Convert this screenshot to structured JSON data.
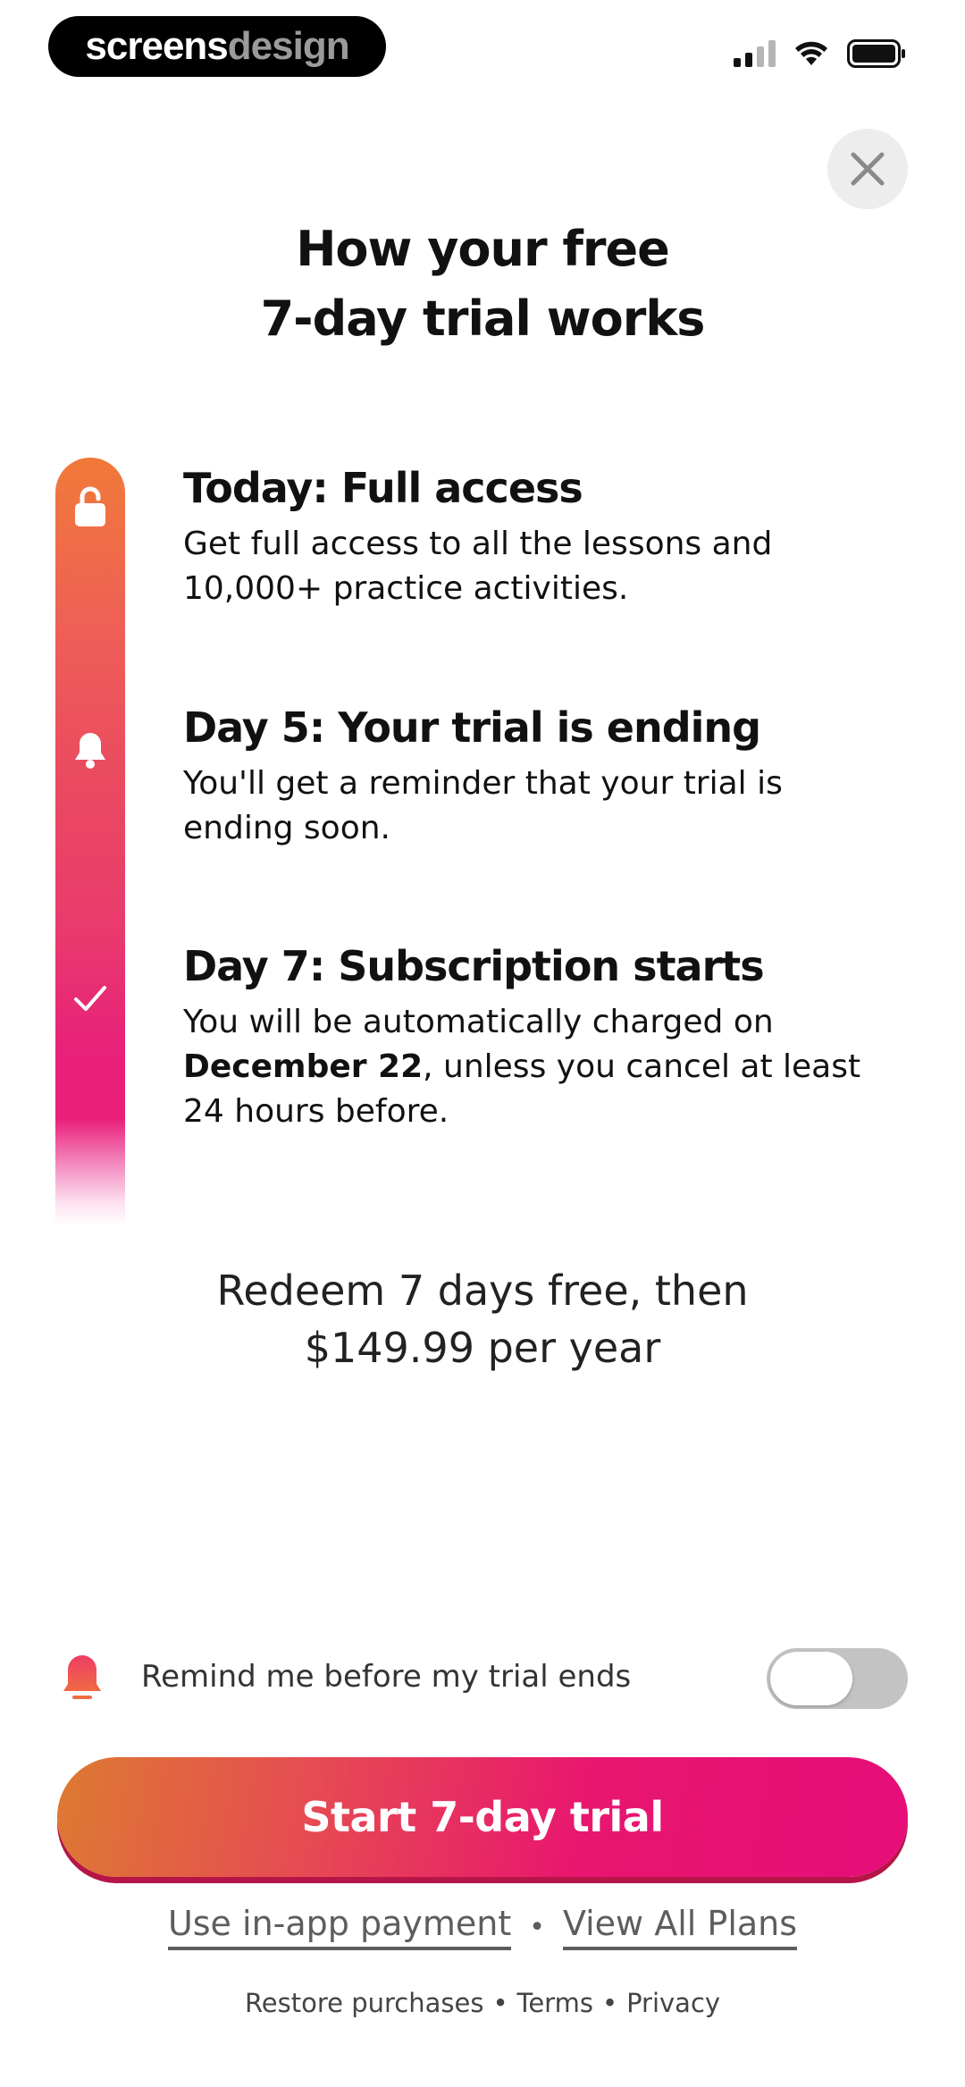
{
  "status_bar": {
    "brand_part1": "screens",
    "brand_part2": "design"
  },
  "header": {
    "title_line1": "How your free",
    "title_line2": "7-day trial works"
  },
  "steps": [
    {
      "title": "Today: Full access",
      "desc": "Get full access to all the lessons and 10,000+ practice activities.",
      "icon": "unlock-icon"
    },
    {
      "title": "Day 5: Your trial is ending",
      "desc": "You'll get a reminder that your trial is ending soon.",
      "icon": "bell-icon"
    },
    {
      "title": "Day 7: Subscription starts",
      "desc_before": "You will be automatically charged on ",
      "desc_bold": "December 22",
      "desc_after": ", unless you cancel at least 24 hours before.",
      "icon": "check-icon"
    }
  ],
  "pricing": {
    "line1": "Redeem 7 days free, then",
    "line2": "$149.99 per year"
  },
  "reminder": {
    "label": "Remind me before my trial ends",
    "toggle_on": false
  },
  "cta": {
    "label": "Start 7-day trial"
  },
  "links": {
    "in_app": "Use in-app payment",
    "separator": "•",
    "view_plans": "View All Plans"
  },
  "footer": {
    "restore": "Restore purchases",
    "sep": "•",
    "terms": "Terms",
    "privacy": "Privacy"
  },
  "colors": {
    "accent_start": "#f07a39",
    "accent_end": "#e8107a",
    "toggle_off": "#c3c3c3"
  }
}
